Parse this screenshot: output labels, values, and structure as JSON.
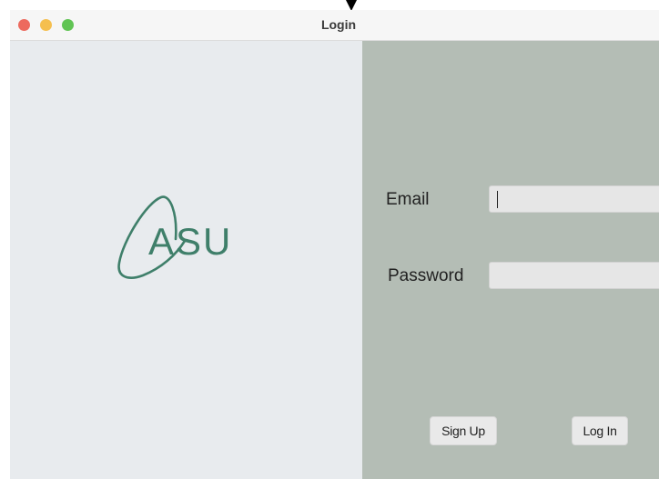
{
  "window": {
    "title": "Login"
  },
  "logo": {
    "text": "ASU",
    "accent_color": "#3f7f6a"
  },
  "form": {
    "email_label": "Email",
    "email_value": "",
    "password_label": "Password",
    "password_value": ""
  },
  "buttons": {
    "signup_label": "Sign Up",
    "login_label": "Log In"
  },
  "icons": {
    "cursor": "mouse-pointer-icon",
    "close": "close-window-icon",
    "minimize": "minimize-window-icon",
    "maximize": "maximize-window-icon"
  },
  "colors": {
    "left_pane": "#e8ebee",
    "right_pane": "#b4bdb5",
    "close": "#ed6a5e",
    "minimize": "#f5bf4f",
    "maximize": "#61c454"
  }
}
